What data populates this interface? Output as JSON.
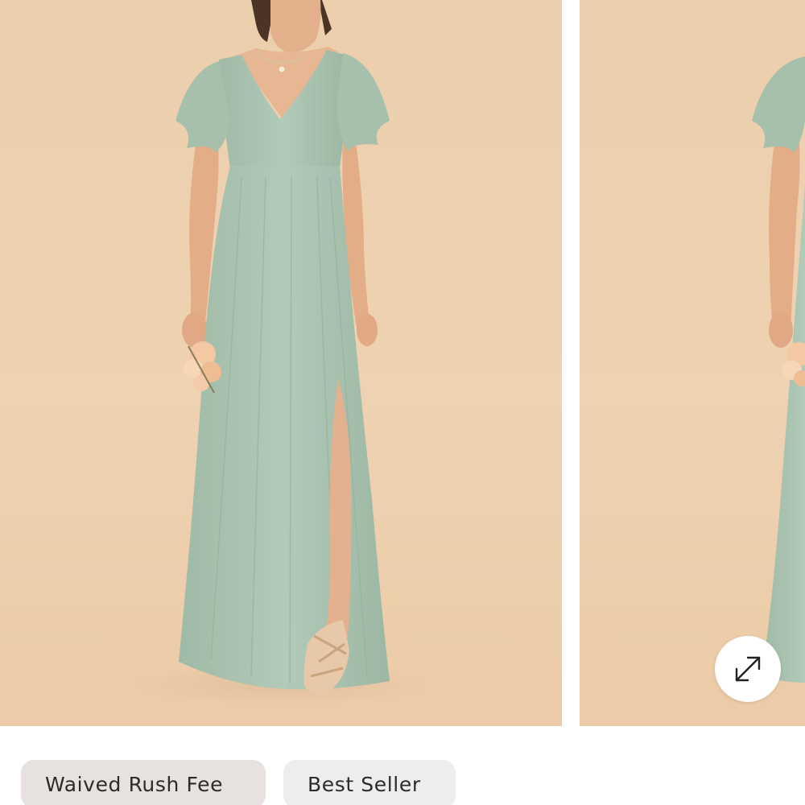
{
  "gallery": {
    "images": [
      {
        "alt": "sage-green-flutter-sleeve-maxi-dress-front"
      },
      {
        "alt": "sage-green-flutter-sleeve-maxi-dress-side"
      }
    ],
    "expand_icon": "expand-arrows-icon"
  },
  "badges": {
    "rush": "Waived Rush Fee",
    "seller": "Best Seller"
  },
  "colors": {
    "background": "#ecd0ae",
    "dress": "#a9c3b0",
    "badge_rush_bg": "#e7e2e0",
    "badge_seller_bg": "#ededed"
  }
}
